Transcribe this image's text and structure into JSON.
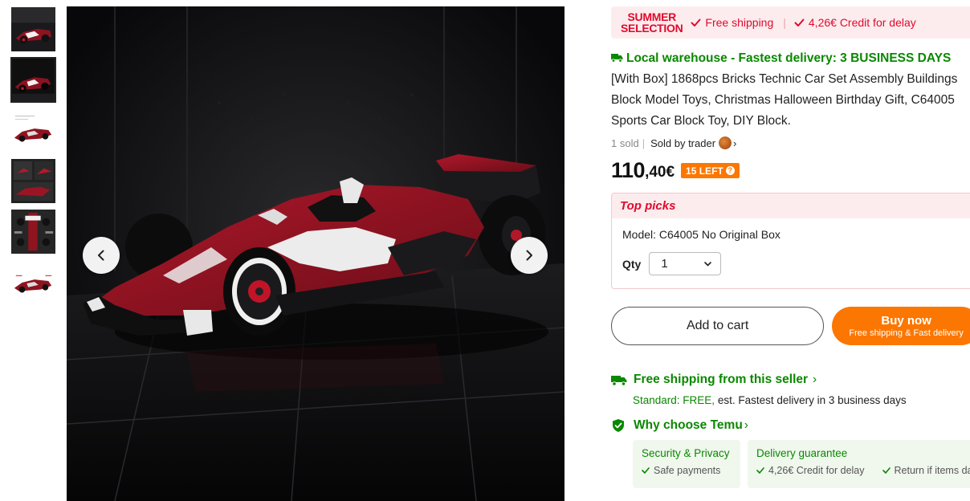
{
  "gallery": {
    "thumbnails": [
      {
        "name": "thumb-1",
        "active": false
      },
      {
        "name": "thumb-2",
        "active": true
      },
      {
        "name": "thumb-3",
        "active": false
      },
      {
        "name": "thumb-4",
        "active": false
      },
      {
        "name": "thumb-5",
        "active": false
      },
      {
        "name": "thumb-6",
        "active": false
      }
    ],
    "prev_icon": "chevron-left-icon",
    "next_icon": "chevron-right-icon"
  },
  "promo": {
    "summer_line1": "SUMMER",
    "summer_line2": "SELECTION",
    "perk1": "Free shipping",
    "separator": "|",
    "perk2": "4,26€ Credit for delay"
  },
  "product": {
    "delivery_prefix": "Local warehouse - Fastest delivery: 3 BUSINESS DAYS",
    "title": " [With Box] 1868pcs Bricks Technic Car Set Assembly Buildings Block Model Toys, Christmas Halloween Birthday Gift, C64005 Sports Car Block Toy, DIY Block.",
    "sold": "1 sold",
    "meta_sep": "|",
    "seller": "Sold by trader",
    "price_int": "110",
    "price_dec": ",40€",
    "stock_badge": "15 LEFT",
    "stock_help": "?"
  },
  "top_picks": {
    "heading": "Top picks",
    "model": "Model: C64005 No Original Box",
    "qty_label": "Qty",
    "qty_value": "1"
  },
  "actions": {
    "add_to_cart": "Add to cart",
    "buy_now": "Buy now",
    "buy_now_sub": "Free shipping & Fast delivery"
  },
  "shipping": {
    "heading": "Free shipping from this seller",
    "standard_label": "Standard: FREE,",
    "standard_text": " est. Fastest delivery in 3 business days"
  },
  "why": {
    "heading": "Why choose Temu",
    "security_title": "Security & Privacy",
    "security_item": "Safe payments",
    "delivery_title": "Delivery guarantee",
    "delivery_item1": "4,26€ Credit for delay",
    "delivery_item2": "Return if items damaged"
  },
  "colors": {
    "accent_red": "#e00a2c",
    "accent_green": "#0a8800",
    "accent_orange": "#fb7701"
  }
}
